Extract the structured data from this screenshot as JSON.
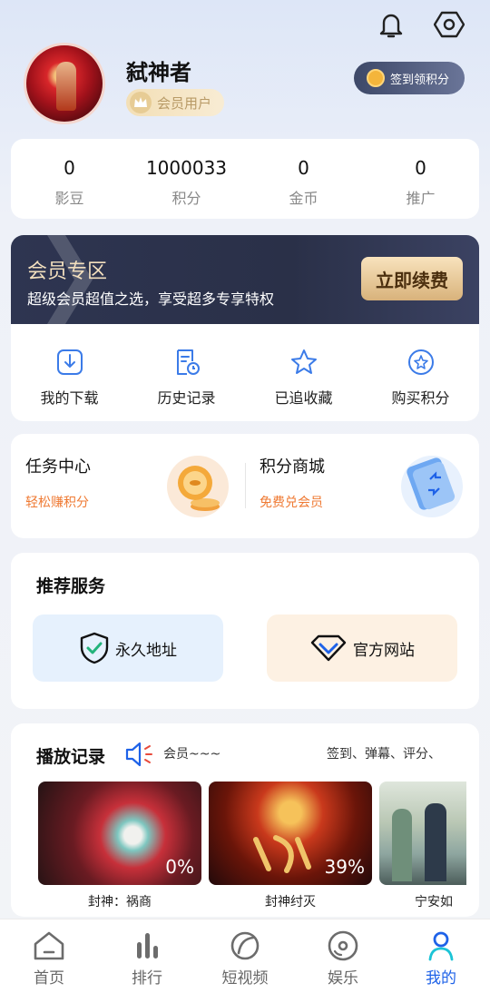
{
  "header": {
    "username": "弑神者",
    "member_badge": "会员用户",
    "checkin_button": "签到领积分"
  },
  "stats": [
    {
      "value": "0",
      "label": "影豆"
    },
    {
      "value": "1000033",
      "label": "积分"
    },
    {
      "value": "0",
      "label": "金币"
    },
    {
      "value": "0",
      "label": "推广"
    }
  ],
  "vip": {
    "title": "会员专区",
    "subtitle": "超级会员超值之选，享受超多专享特权",
    "renew_button": "立即续费"
  },
  "quick_actions": [
    {
      "label": "我的下载",
      "icon": "download-icon"
    },
    {
      "label": "历史记录",
      "icon": "history-icon"
    },
    {
      "label": "已追收藏",
      "icon": "star-icon"
    },
    {
      "label": "购买积分",
      "icon": "buy-points-icon"
    }
  ],
  "tasks": {
    "task_center": {
      "title": "任务中心",
      "subtitle": "轻松赚积分"
    },
    "points_mall": {
      "title": "积分商城",
      "subtitle": "免费兑会员"
    }
  },
  "recommend": {
    "title": "推荐服务",
    "permanent_url": "永久地址",
    "official_site": "官方网站"
  },
  "history": {
    "title": "播放记录",
    "marquee": "会员~~~",
    "tags": "签到、弹幕、评分、",
    "items": [
      {
        "title": "封神：祸商",
        "progress": "0%"
      },
      {
        "title": "封神纣灭",
        "progress": "39%"
      },
      {
        "title": "宁安如",
        "progress": ""
      }
    ]
  },
  "tabbar": [
    {
      "label": "首页",
      "icon": "home-icon"
    },
    {
      "label": "排行",
      "icon": "rank-icon"
    },
    {
      "label": "短视频",
      "icon": "short-video-icon"
    },
    {
      "label": "娱乐",
      "icon": "entertainment-icon"
    },
    {
      "label": "我的",
      "icon": "profile-icon",
      "active": true
    }
  ],
  "colors": {
    "accent": "#1e62e8",
    "orange": "#ef7a33",
    "vip_gold": "#f2dfbe"
  }
}
